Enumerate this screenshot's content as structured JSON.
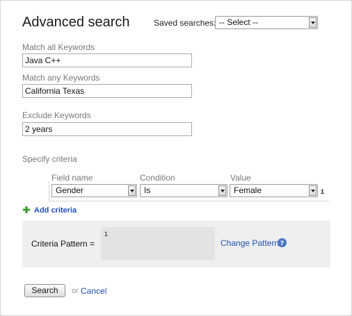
{
  "header": {
    "title": "Advanced search",
    "saved_searches_label": "Saved searches:",
    "saved_searches_value": "-- Select --"
  },
  "keywords": {
    "match_all_label": "Match all Keywords",
    "match_all_value": "Java C++",
    "match_any_label": "Match any Keywords",
    "match_any_value": "California Texas",
    "exclude_label": "Exclude Keywords",
    "exclude_value": "2 years"
  },
  "criteria": {
    "section_label": "Specify criteria",
    "columns": [
      "Field name",
      "Condition",
      "Value"
    ],
    "rows": [
      {
        "field": "Gender",
        "condition": "Is",
        "value": "Female",
        "number": "1"
      }
    ],
    "add_label": "Add criteria"
  },
  "pattern": {
    "label": "Criteria Pattern =",
    "value": "1",
    "change_label": "Change Pattern"
  },
  "actions": {
    "search_label": "Search",
    "or_label": "or",
    "cancel_label": "Cancel"
  },
  "icons": {
    "add": "plus-icon",
    "help": "question-mark-icon"
  },
  "colors": {
    "link": "#1f4fb3",
    "add_icon": "#3c9a2e",
    "help_icon": "#4a78c2",
    "panel": "#efefef"
  }
}
